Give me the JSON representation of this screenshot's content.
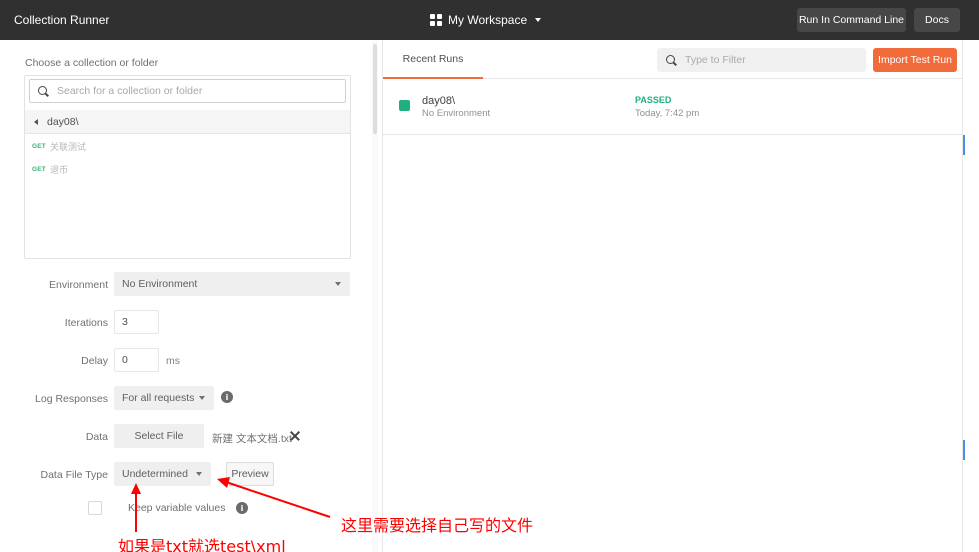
{
  "topbar": {
    "title": "Collection Runner",
    "workspace": "My Workspace",
    "run_cli": "Run In Command Line",
    "docs": "Docs"
  },
  "left": {
    "choose_label": "Choose a collection or folder",
    "search_placeholder": "Search for a collection or folder",
    "folder": "day08\\",
    "requests": [
      {
        "method": "GET",
        "name": "关联测试"
      },
      {
        "method": "GET",
        "name": "退币"
      }
    ]
  },
  "form": {
    "environment": {
      "label": "Environment",
      "value": "No Environment"
    },
    "iterations": {
      "label": "Iterations",
      "value": "3"
    },
    "delay": {
      "label": "Delay",
      "value": "0",
      "unit": "ms"
    },
    "log_responses": {
      "label": "Log Responses",
      "value": "For all requests"
    },
    "data": {
      "label": "Data",
      "button": "Select File",
      "file_name": "新建 文本文档.txt"
    },
    "data_file_type": {
      "label": "Data File Type",
      "value": "Undetermined",
      "preview": "Preview"
    },
    "keep_variable": {
      "label": "Keep variable values",
      "checked": false
    }
  },
  "annotations": {
    "note_file": "这里需要选择自己写的文件",
    "note_type": "如果是txt就选test\\xml",
    "color": "#ff0000"
  },
  "right": {
    "tab": "Recent Runs",
    "filter_placeholder": "Type to Filter",
    "import_button": "Import Test Run",
    "runs": [
      {
        "name": "day08\\",
        "environment": "No Environment",
        "status": "PASSED",
        "time": "Today, 7:42 pm"
      }
    ]
  },
  "colors": {
    "topbar": "#303030",
    "accent": "#f26b3a",
    "passed": "#20b080",
    "get_method": "#3fb07a"
  },
  "icons": [
    "workspace-grid-icon",
    "chevron-down-icon",
    "search-icon",
    "caret-left-icon",
    "info-icon",
    "close-icon",
    "filter-search-icon"
  ]
}
